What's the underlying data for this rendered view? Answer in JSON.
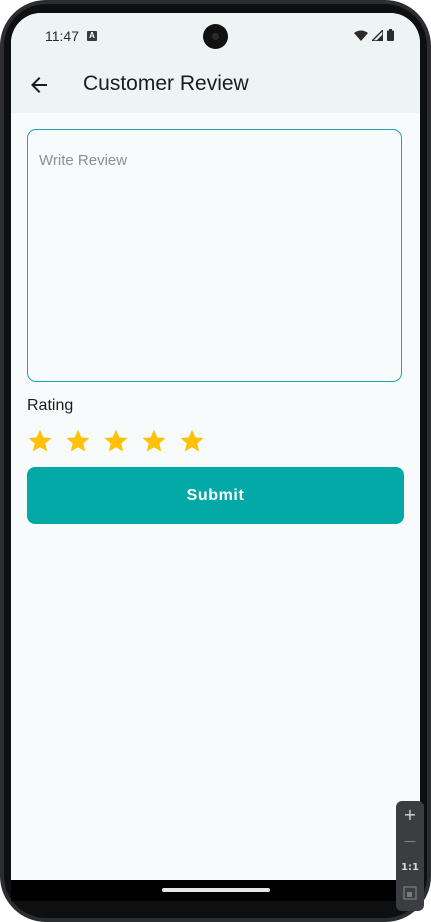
{
  "status_bar": {
    "time": "11:47",
    "notification_badge": "A"
  },
  "app_bar": {
    "title": "Customer Review",
    "back_icon": "arrow-left-icon"
  },
  "review": {
    "placeholder": "Write Review",
    "value": ""
  },
  "rating": {
    "label": "Rating",
    "max": 5,
    "value": 5,
    "star_color": "#FFC107"
  },
  "submit": {
    "label": "Submit",
    "color": "#03A9A6"
  },
  "emulator_controls": {
    "zoom_in": "+",
    "zoom_out": "—",
    "one_to_one": "1:1"
  }
}
